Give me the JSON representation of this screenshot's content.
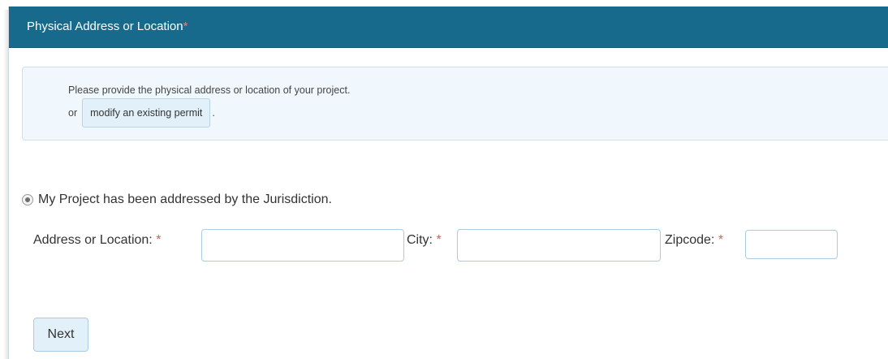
{
  "header": {
    "title": "Physical Address or Location",
    "required_mark": "*"
  },
  "info": {
    "line1": "Please provide the physical address or location of your project.",
    "or_text": "or",
    "modify_button_label": "modify an existing permit",
    "trailing_period": "."
  },
  "radio_option": {
    "label": "My Project has been addressed by the Jurisdiction.",
    "selected": true
  },
  "fields": {
    "address_label": "Address or Location:",
    "address_value": "",
    "city_label": "City:",
    "city_value": "",
    "zipcode_label": "Zipcode:",
    "zipcode_value": "",
    "required_mark": "*"
  },
  "actions": {
    "next_label": "Next"
  },
  "colors": {
    "header_bg": "#186a8d",
    "info_bg": "#f1f8fd",
    "button_bg": "#e2f0fa",
    "required": "#e05a5a"
  }
}
